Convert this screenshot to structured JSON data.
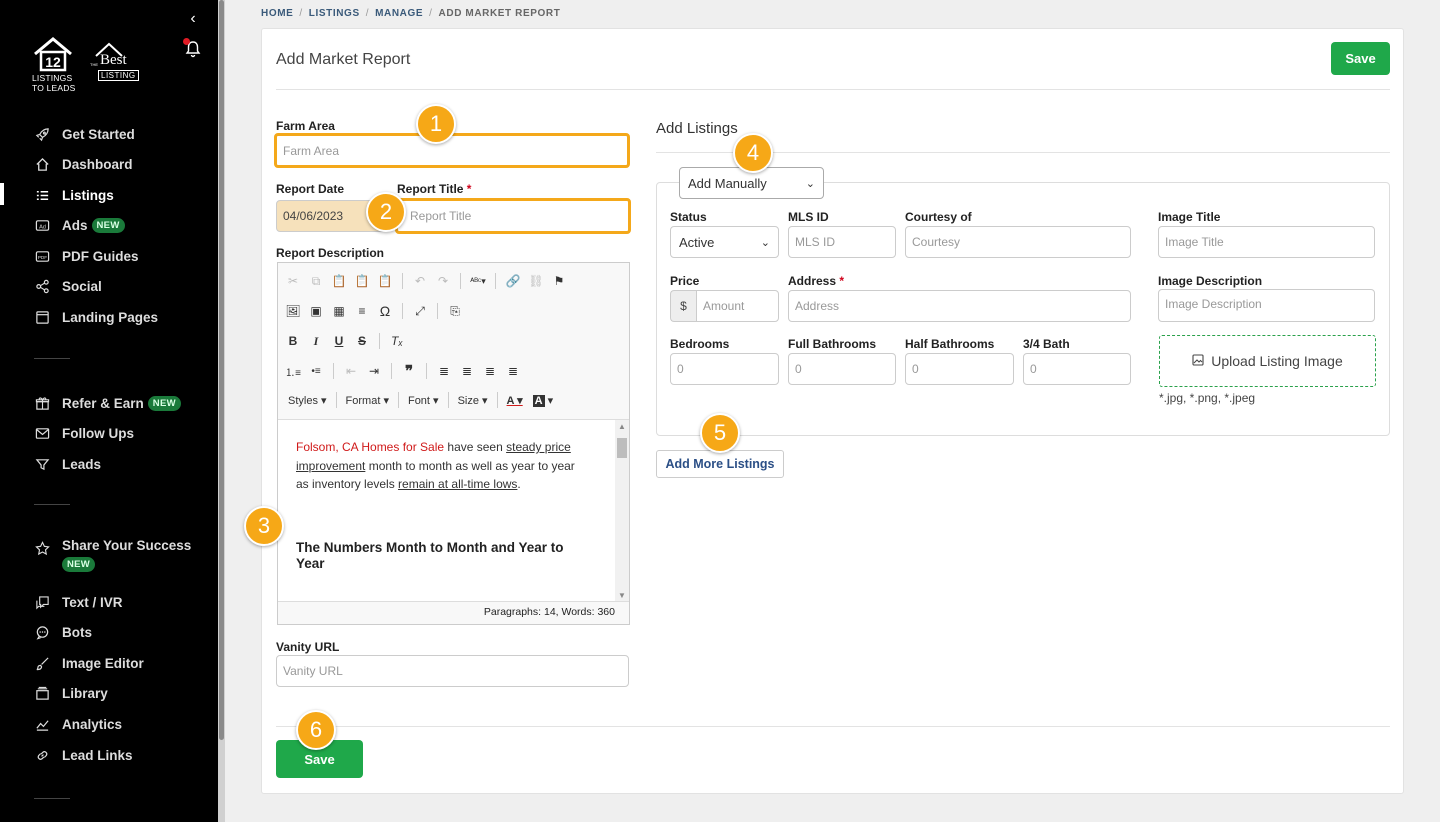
{
  "sidebar": {
    "logo_a_text": "LISTINGS TO LEADS",
    "logo_a_mark": "12",
    "logo_b_best": "Best",
    "logo_b_the": "THE",
    "logo_b_listing": "LISTING",
    "new_badge": "NEW",
    "items": [
      {
        "label": "Get Started",
        "icon": "rocket-icon"
      },
      {
        "label": "Dashboard",
        "icon": "home-icon"
      },
      {
        "label": "Listings",
        "icon": "list-icon"
      },
      {
        "label": "Ads",
        "icon": "ad-icon"
      },
      {
        "label": "PDF Guides",
        "icon": "pdf-icon"
      },
      {
        "label": "Social",
        "icon": "share-icon"
      },
      {
        "label": "Landing Pages",
        "icon": "page-icon"
      },
      {
        "label": "Refer & Earn",
        "icon": "gift-icon"
      },
      {
        "label": "Follow Ups",
        "icon": "mail-icon"
      },
      {
        "label": "Leads",
        "icon": "filter-icon"
      },
      {
        "label": "Share Your Success",
        "icon": "star-icon"
      },
      {
        "label": "Text / IVR",
        "icon": "sms-icon"
      },
      {
        "label": "Bots",
        "icon": "chat-icon"
      },
      {
        "label": "Image Editor",
        "icon": "brush-icon"
      },
      {
        "label": "Library",
        "icon": "folder-icon"
      },
      {
        "label": "Analytics",
        "icon": "chart-icon"
      },
      {
        "label": "Lead Links",
        "icon": "link-icon"
      }
    ]
  },
  "breadcrumb": [
    "HOME",
    "LISTINGS",
    "MANAGE",
    "ADD MARKET REPORT"
  ],
  "card": {
    "title": "Add Market Report",
    "save_label": "Save"
  },
  "form": {
    "farm_area_label": "Farm Area",
    "farm_area_placeholder": "Farm Area",
    "report_date_label": "Report Date",
    "report_date_value": "04/06/2023",
    "report_title_label": "Report Title",
    "report_title_placeholder": "Report Title",
    "required_mark": "*",
    "report_description_label": "Report Description",
    "vanity_url_label": "Vanity URL",
    "vanity_url_placeholder": "Vanity URL"
  },
  "editor": {
    "combos": [
      "Styles",
      "Format",
      "Font",
      "Size"
    ],
    "text_red": "Folsom, CA Homes for Sale",
    "text_1": " have seen ",
    "text_link1": "steady price improvement",
    "text_2": " month to month as well as year to year as inventory levels ",
    "text_link2": "remain at all-time lows",
    "text_3": ".",
    "heading": "The Numbers Month to Month and Year to Year",
    "status": "Paragraphs: 14, Words: 360"
  },
  "listings": {
    "title": "Add Listings",
    "mode": "Add Manually",
    "status_label": "Status",
    "status_value": "Active",
    "mls_label": "MLS ID",
    "mls_placeholder": "MLS ID",
    "courtesy_label": "Courtesy of",
    "courtesy_placeholder": "Courtesy",
    "image_title_label": "Image Title",
    "image_title_placeholder": "Image Title",
    "price_label": "Price",
    "price_addon": "$",
    "price_placeholder": "Amount",
    "address_label": "Address",
    "address_placeholder": "Address",
    "image_desc_label": "Image Description",
    "image_desc_placeholder": "Image Description",
    "bedrooms_label": "Bedrooms",
    "full_baths_label": "Full Bathrooms",
    "half_baths_label": "Half Bathrooms",
    "three_quarter_label": "3/4 Bath",
    "zero": "0",
    "upload_label": "Upload Listing Image",
    "upload_hint": "*.jpg, *.png, *.jpeg",
    "add_more_label": "Add More Listings"
  },
  "markers": [
    "1",
    "2",
    "3",
    "4",
    "5",
    "6"
  ],
  "colors": {
    "accent_green": "#1fa84a",
    "marker_orange": "#f6a817",
    "link_blue": "#2b4f86"
  }
}
